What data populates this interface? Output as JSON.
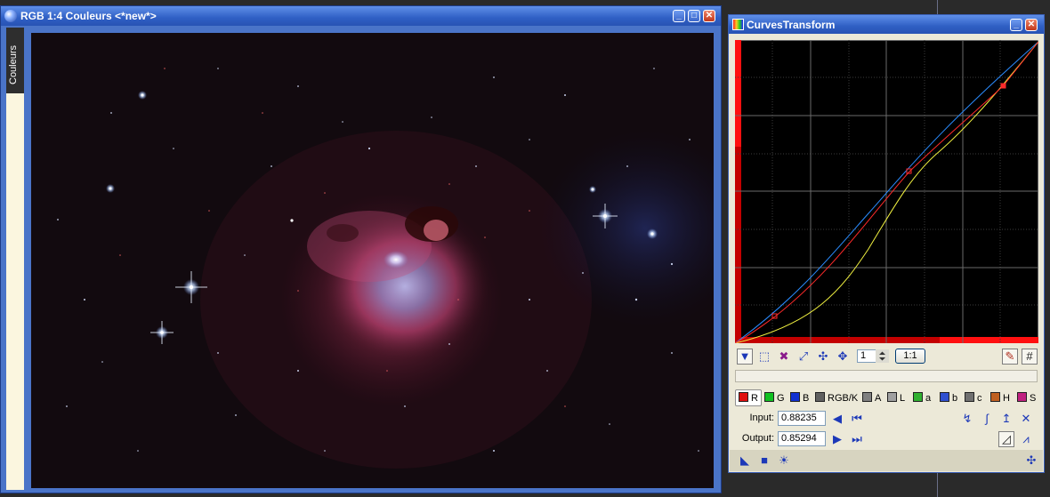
{
  "image_window": {
    "title": "RGB 1:4 Couleurs <*new*>",
    "side_tab_label": "Couleurs",
    "controls": {
      "minimize": "_",
      "maximize": "□",
      "close": "✕"
    }
  },
  "curves_window": {
    "title": "CurvesTransform",
    "controls": {
      "minimize": "_",
      "close": "✕"
    },
    "zoom_value": "1",
    "one_to_one_label": "1:1",
    "channels": [
      {
        "label": "R",
        "color": "#e01010",
        "active": true
      },
      {
        "label": "G",
        "color": "#10c020"
      },
      {
        "label": "B",
        "color": "#1030d0"
      },
      {
        "label": "RGB/K",
        "color": "#606060"
      },
      {
        "label": "A",
        "color": "#808080"
      },
      {
        "label": "L",
        "color": "#a0a0a0"
      },
      {
        "label": "a",
        "color": "#30b030"
      },
      {
        "label": "b",
        "color": "#3050d0"
      },
      {
        "label": "c",
        "color": "#707070"
      },
      {
        "label": "H",
        "color": "#c06020"
      },
      {
        "label": "S",
        "color": "#c02080"
      }
    ],
    "input_label": "Input:",
    "input_value": "0.88235",
    "output_label": "Output:",
    "output_value": "0.85294",
    "curve_colors": {
      "red": "#ff2a2a",
      "green": "#f0f040",
      "blue": "#2a8cff"
    },
    "icons": {
      "toolbar": [
        "edit-mode-icon",
        "select-mode-icon",
        "delete-mode-icon",
        "zoom-fit-icon",
        "zoom-in-icon",
        "pan-icon"
      ],
      "right_toolbar": [
        "show-all-curves-icon",
        "grid-icon"
      ],
      "input_row": [
        "previous-point-icon",
        "first-point-icon",
        "invert-curve-icon",
        "spline-interpolation-icon",
        "linear-interpolation-icon",
        "reset-curve-icon"
      ],
      "output_row": [
        "next-point-icon",
        "last-point-icon",
        "histogram-icon",
        "graph-icon"
      ],
      "bottom": [
        "new-instance-icon",
        "apply-global-icon",
        "real-time-preview-icon",
        "reset-all-icon"
      ]
    }
  }
}
